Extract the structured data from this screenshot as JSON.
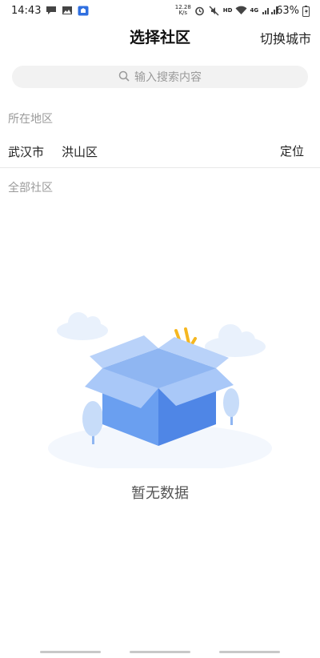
{
  "status_bar": {
    "time": "14:43",
    "net_speed_value": "12.28",
    "net_speed_unit": "K/s",
    "hd_label": "HD",
    "network_label": "4G",
    "battery": "63%",
    "icons": [
      "chat-bubble-icon",
      "image-icon",
      "app-icon",
      "alarm-icon",
      "mute-icon",
      "wifi-icon",
      "signal-icon",
      "battery-icon"
    ]
  },
  "header": {
    "title": "选择社区",
    "switch_city": "切换城市"
  },
  "search": {
    "placeholder": "输入搜索内容"
  },
  "region_section": {
    "label": "所在地区",
    "city": "武汉市",
    "district": "洪山区",
    "locate_label": "定位"
  },
  "community_section": {
    "label": "全部社区"
  },
  "empty_state": {
    "message": "暂无数据",
    "illustration": "empty-box-illustration"
  },
  "colors": {
    "box_blue": "#6a9ff0",
    "box_light": "#a9c8f8",
    "cloud": "#e9f1fc",
    "sparkle_yellow": "#f5b720",
    "search_bg": "#f2f2f2",
    "secondary_text": "#9a9a9a"
  }
}
